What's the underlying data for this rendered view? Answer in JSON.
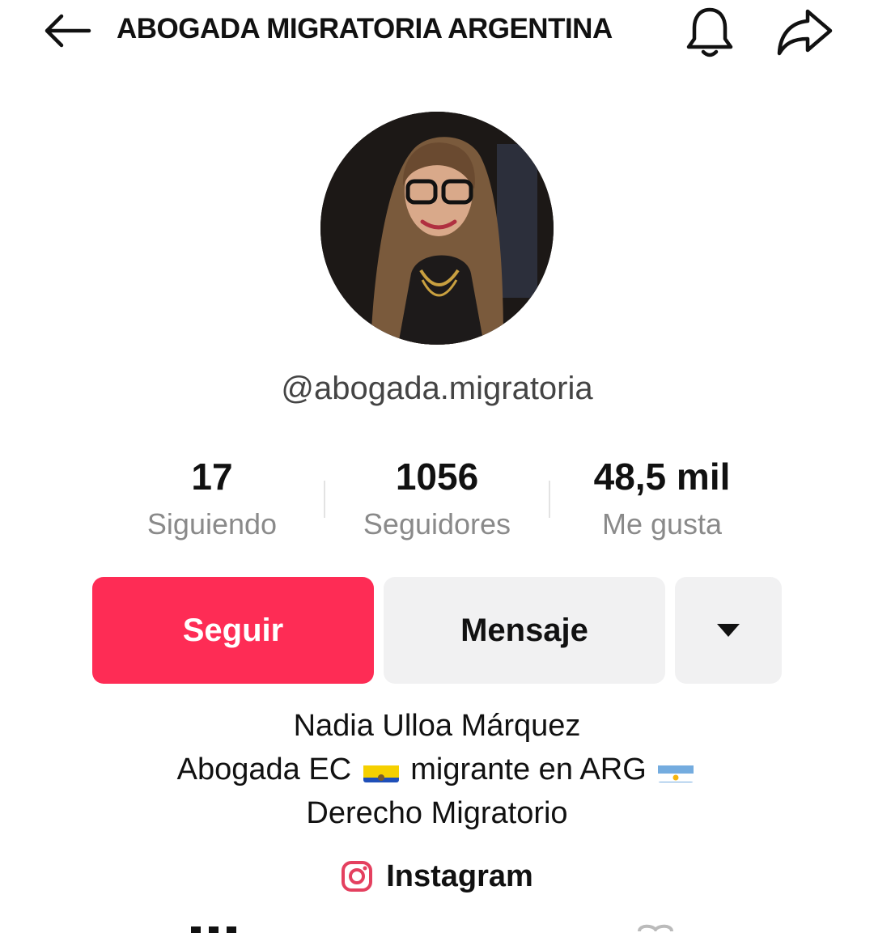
{
  "header": {
    "title": "ABOGADA MIGRATORIA ARGENTINA",
    "back_icon": "arrow-left-icon",
    "bell_icon": "bell-icon",
    "share_icon": "share-arrow-icon"
  },
  "profile": {
    "handle": "@abogada.migratoria",
    "avatar": "profile-photo"
  },
  "stats": [
    {
      "value": "17",
      "label": "Siguiendo"
    },
    {
      "value": "1056",
      "label": "Seguidores"
    },
    {
      "value": "48,5 mil",
      "label": "Me gusta"
    }
  ],
  "actions": {
    "follow_label": "Seguir",
    "message_label": "Mensaje",
    "more_icon": "caret-down-icon"
  },
  "bio": {
    "name": "Nadia Ulloa Márquez",
    "line2_a": "Abogada EC",
    "line2_b": "migrante en ARG",
    "line3": "Derecho Migratorio"
  },
  "link": {
    "label": "Instagram",
    "icon": "instagram-icon"
  },
  "colors": {
    "accent": "#fe2c55",
    "button_bg": "#f1f1f2",
    "secondary_text": "#8a8a8a"
  }
}
